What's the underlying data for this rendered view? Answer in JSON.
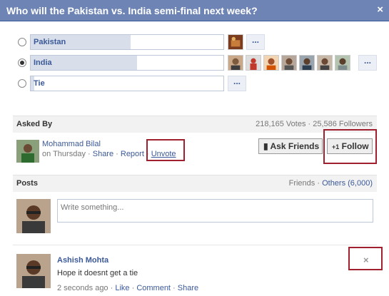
{
  "dialog": {
    "title": "Who will the Pakistan vs. India semi-final next week?",
    "close_icon": "×"
  },
  "poll": {
    "options": [
      {
        "label": "Pakistan",
        "selected": false,
        "vote_fraction": 0.52
      },
      {
        "label": "India",
        "selected": true,
        "vote_fraction": 0.55
      },
      {
        "label": "Tie",
        "selected": false,
        "vote_fraction": 0.02
      }
    ],
    "more_label": "..."
  },
  "asked_by": {
    "header": "Asked By",
    "stats": "218,165 Votes · 25,586 Followers",
    "name": "Mohammad Bilal",
    "meta_prefix": "on Thursday · ",
    "share": "Share",
    "report": "Report",
    "sep": " · ",
    "unvote": "Unvote",
    "ask_friends": "Ask Friends",
    "follow_prefix": "+1",
    "follow": "Follow"
  },
  "posts": {
    "header": "Posts",
    "friends": "Friends",
    "others": "Others (6,000)",
    "placeholder": "Write something..."
  },
  "comment": {
    "name": "Ashish Mohta",
    "text": "Hope it doesnt get a tie",
    "time": "2 seconds ago",
    "like": "Like",
    "comment": "Comment",
    "share": "Share"
  },
  "colors": {
    "titlebar": "#6d84b4",
    "link": "#3b5998",
    "highlight_box": "#a02030"
  }
}
